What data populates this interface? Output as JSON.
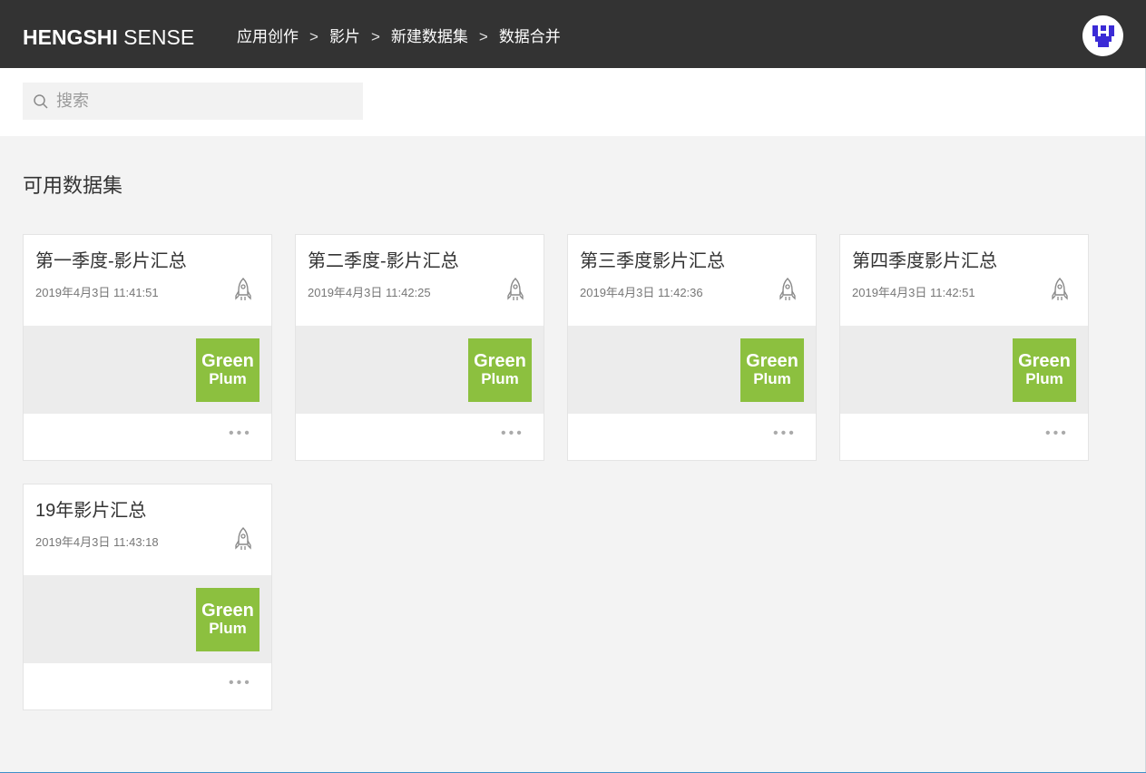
{
  "header": {
    "brand_bold": "HENGSHI",
    "brand_light": " SENSE",
    "breadcrumb": [
      "应用创作",
      "影片",
      "新建数据集",
      "数据合并"
    ],
    "separator": ">",
    "avatar_icon": "user-avatar-icon"
  },
  "search": {
    "placeholder": "搜索",
    "value": "",
    "icon": "search-icon"
  },
  "section": {
    "title": "可用数据集"
  },
  "cards": [
    {
      "title": "第一季度-影片汇总",
      "time": "2019年4月3日 11:41:51",
      "logo_line1": "Green",
      "logo_line2": "Plum",
      "more": "•••"
    },
    {
      "title": "第二季度-影片汇总",
      "time": "2019年4月3日 11:42:25",
      "logo_line1": "Green",
      "logo_line2": "Plum",
      "more": "•••"
    },
    {
      "title": "第三季度影片汇总",
      "time": "2019年4月3日 11:42:36",
      "logo_line1": "Green",
      "logo_line2": "Plum",
      "more": "•••"
    },
    {
      "title": "第四季度影片汇总",
      "time": "2019年4月3日 11:42:51",
      "logo_line1": "Green",
      "logo_line2": "Plum",
      "more": "•••"
    },
    {
      "title": "19年影片汇总",
      "time": "2019年4月3日 11:43:18",
      "logo_line1": "Green",
      "logo_line2": "Plum",
      "more": "•••"
    }
  ],
  "colors": {
    "topbar": "#333333",
    "accent_green": "#8cc03f",
    "page_bg": "#f3f3f3"
  }
}
